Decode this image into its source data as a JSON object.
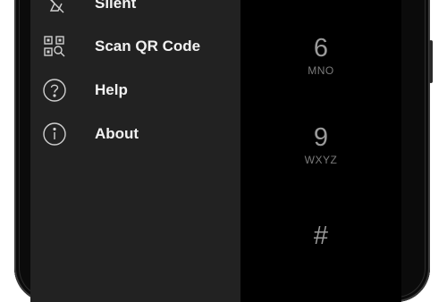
{
  "drawer": {
    "items": [
      {
        "id": "silent",
        "label": "Silent",
        "icon": "silent-icon"
      },
      {
        "id": "scan-qr-code",
        "label": "Scan QR Code",
        "icon": "qr-code-icon"
      },
      {
        "id": "help",
        "label": "Help",
        "icon": "help-icon"
      },
      {
        "id": "about",
        "label": "About",
        "icon": "info-icon"
      }
    ]
  },
  "dialpad": {
    "keys": [
      {
        "digit": "6",
        "letters": "MNO"
      },
      {
        "digit": "9",
        "letters": "WXYZ"
      },
      {
        "digit": "#",
        "letters": ""
      }
    ]
  },
  "colors": {
    "drawer_background": "#222222",
    "screen_background": "#000000",
    "menu_text": "#f2f2f2",
    "key_digit": "#9a9a9a",
    "key_letters": "#7a7a7a"
  }
}
